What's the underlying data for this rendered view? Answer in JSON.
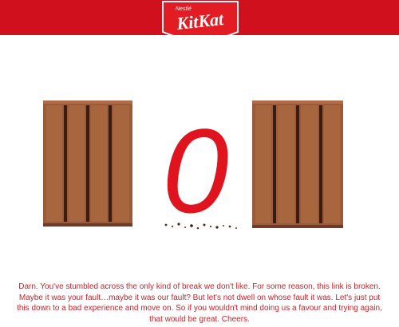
{
  "header": {
    "brand_parent": "Nestlé",
    "brand_logo": "KitKat",
    "color": "#d0101d"
  },
  "error": {
    "code_digit": "0",
    "icon_left": "chocolate-bar-icon",
    "icon_right": "chocolate-bar-icon"
  },
  "message": {
    "text": "Darn. You've stumbled across the only kind of break we don't like. For some reason, this link is broken. Maybe it was your fault…maybe it was our fault? But let's not dwell on whose fault it was. Let's just put this down to a bad experience and move on. So if you wouldn't mind doing us a favour and trying again, that would be great. Cheers.",
    "color": "#c8232c"
  }
}
